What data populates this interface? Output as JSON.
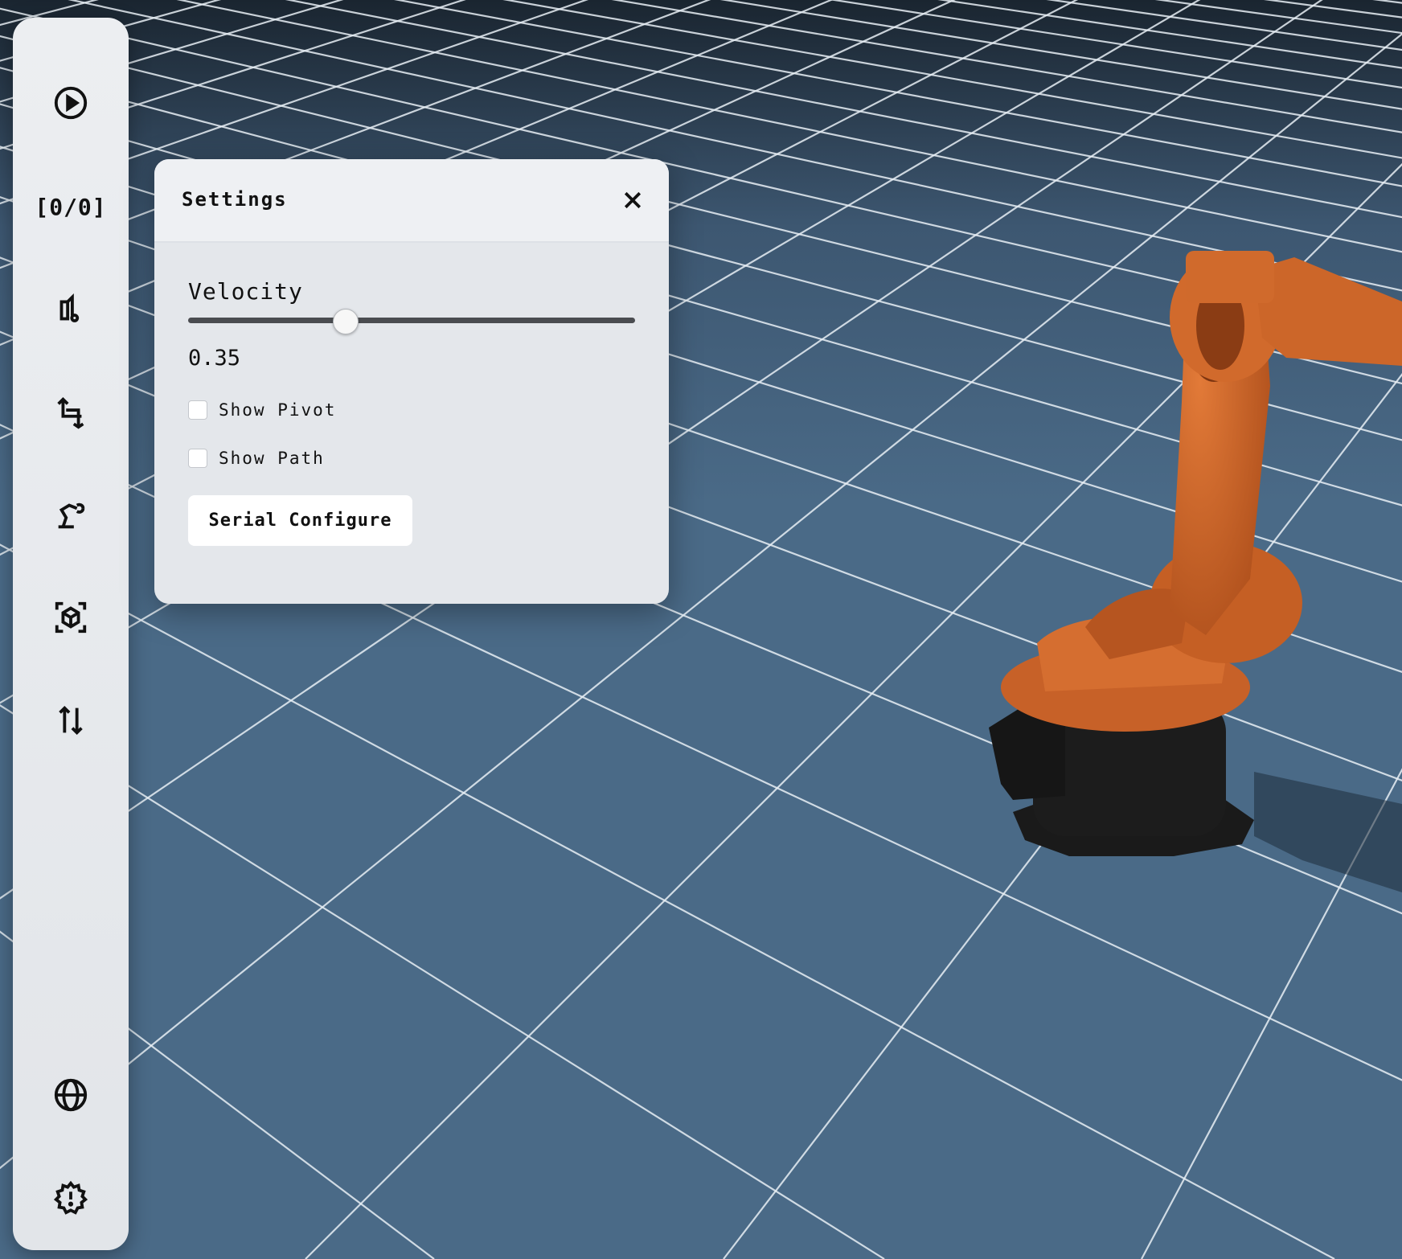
{
  "toolbar": {
    "items": [
      {
        "name": "play-button",
        "icon": "play-circle-icon"
      },
      {
        "name": "waypoint-counter",
        "label": "[0/0]"
      },
      {
        "name": "gripper-button",
        "icon": "gripper-icon"
      },
      {
        "name": "transform-button",
        "icon": "crop-transform-icon"
      },
      {
        "name": "robot-arm-button",
        "icon": "robot-arm-icon"
      },
      {
        "name": "view-cube-button",
        "icon": "view-cube-icon"
      },
      {
        "name": "swap-button",
        "icon": "arrows-up-down-icon"
      },
      {
        "name": "language-button",
        "icon": "globe-icon"
      },
      {
        "name": "settings-button",
        "icon": "gear-alert-icon"
      }
    ],
    "counter_label": "[0/0]"
  },
  "settings": {
    "title": "Settings",
    "velocity_label": "Velocity",
    "velocity_value": "0.35",
    "velocity_fraction": 0.35,
    "show_pivot_label": "Show Pivot",
    "show_path_label": "Show Path",
    "serial_configure_label": "Serial Configure"
  },
  "colors": {
    "floor": "#4a6a87",
    "grid_line": "#e8eef4",
    "panel_bg": "#e4e7eb",
    "robot_orange": "#d4692a",
    "robot_base": "#1c1c1c"
  }
}
